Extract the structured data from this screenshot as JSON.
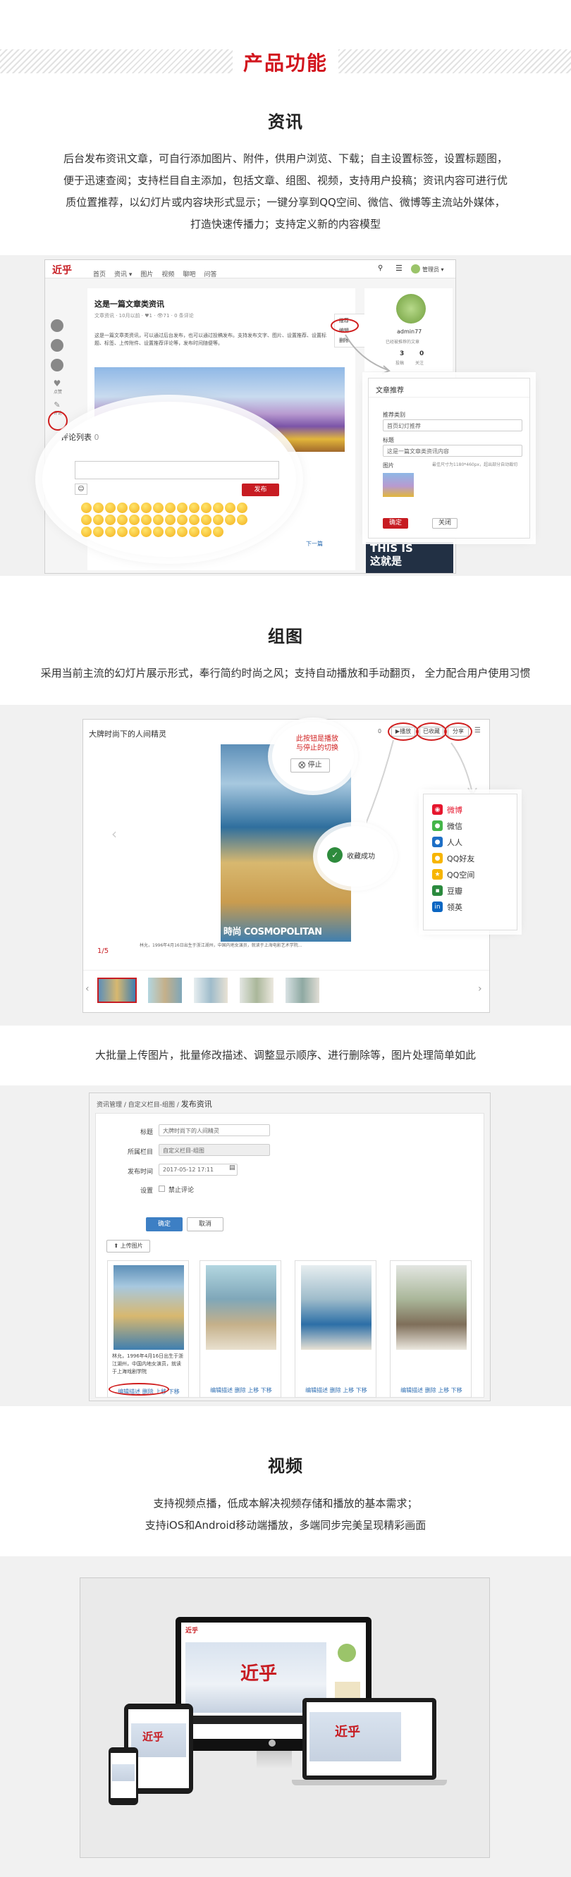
{
  "banner": {
    "title": "产品功能"
  },
  "news": {
    "title": "资讯",
    "lines": [
      "后台发布资讯文章，可自行添加图片、附件，供用户浏览、下载；自主设置标签，设置标题图，",
      "便于迅速查阅；支持栏目自主添加，包括文章、组图、视频，支持用户投稿；资讯内容可进行优",
      "质位置推荐，以幻灯片或内容块形式显示；一键分享到QQ空间、微信、微博等主流站外媒体，",
      "打造快速传播力；支持定义新的内容模型"
    ],
    "nav": {
      "logo": "近乎",
      "items": [
        "首页",
        "资讯 ▾",
        "图片",
        "视频",
        "聊吧",
        "问答"
      ],
      "user": "管理员 ▾"
    },
    "article": {
      "title": "这是一篇文章类资讯",
      "meta": "文章资讯 · 10月以前 · ♥1 · 👁71 · 0 条评论",
      "body": "这是一篇文章类资讯，可以通过后台发布，也可以通过投稿发布。支持发布文字、图片、设置推荐、设置标题、标签、上传附件、设置推荐评论等，发布时间随便等。"
    },
    "sidebar_labels": {
      "like": "点赞",
      "comment": "评论"
    },
    "recommend_menu": [
      "推荐",
      "编辑",
      "删除"
    ],
    "profile": {
      "name": "admin77",
      "stats": [
        {
          "n": "3",
          "l": "投稿"
        },
        {
          "n": "0",
          "l": "关注"
        }
      ],
      "badge": "已经被推荐的文章"
    },
    "comments": {
      "title": "评论列表",
      "count": "0",
      "publish": "发布"
    },
    "recommend_dialog": {
      "title": "文章推荐",
      "type_label": "推荐类别",
      "type_value": "首页幻灯推荐",
      "title_label": "标题",
      "title_value": "这是一篇文章类资讯内容",
      "image_label": "图片",
      "image_hint": "最佳尺寸为1180*460px，超出部分自动裁切",
      "ok": "确定",
      "cancel": "关闭"
    },
    "side_banner": {
      "line1": "THIS IS",
      "line2": "这就是"
    },
    "next": "下一篇"
  },
  "gallery": {
    "title": "组图",
    "desc": "采用当前主流的幻灯片展示形式，奉行简约时尚之风；支持自动播放和手动翻页， 全力配合用户使用习惯",
    "viewer_title": "大牌时尚下的人间精灵",
    "buttons": {
      "play": "播放",
      "collect": "已收藏",
      "share": "分享",
      "count": "0"
    },
    "callout": "此按钮是播放\n与停止的切换",
    "stop": "停止",
    "collect_ok": "收藏成功",
    "share_menu": [
      "微博",
      "微信",
      "人人",
      "QQ好友",
      "QQ空间",
      "豆瓣",
      "领英"
    ],
    "counter": "1/5",
    "caption": "林允，1996年4月16日出生于浙江湖州，中国内地女演员，就读于上海电影艺术学院...",
    "cover_text": "時尚 COSMOPOLITAN"
  },
  "upload": {
    "desc": "大批量上传图片，批量修改描述、调整显示顺序、进行删除等，图片处理简单如此",
    "breadcrumb": [
      "资讯管理",
      "自定义栏目-组图",
      "发布资讯"
    ],
    "form": [
      {
        "label": "标题",
        "value": "大牌时尚下的人间精灵"
      },
      {
        "label": "所属栏目",
        "value": "自定义栏目-组图"
      },
      {
        "label": "发布时间",
        "value": "2017-05-12 17:11"
      }
    ],
    "settings_label": "设置",
    "no_comment": "禁止评论",
    "ok": "确定",
    "cancel": "取消",
    "upload_btn": "上传图片",
    "card1_text": "林允，1996年4月16日出生于浙江湖州，中国内地女演员，就读于上海戏剧学院",
    "card_actions": "编辑描述 删除 上移 下移"
  },
  "video": {
    "title": "视频",
    "lines": [
      "支持视频点播，低成本解决视频存储和播放的基本需求；",
      "支持iOS和Android移动端播放，多端同步完美呈现精彩画面"
    ],
    "screen_logo": "近乎"
  }
}
